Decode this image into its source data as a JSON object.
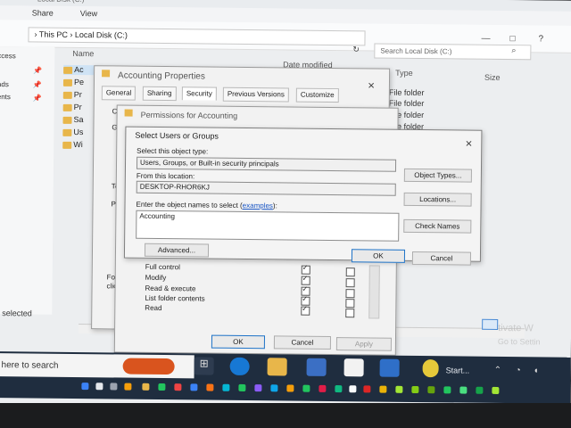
{
  "explorer": {
    "title": "Local Disk (C:)",
    "ribbon": [
      "Share",
      "View"
    ],
    "breadcrumb": [
      "This PC",
      "Local Disk (C:)"
    ],
    "search_placeholder": "Search Local Disk (C:)",
    "columns": [
      "Name",
      "Date modified",
      "Type",
      "Size"
    ],
    "nav_items": [
      "ccess",
      "ads",
      "ents"
    ],
    "folders": [
      "Ac",
      "Pe",
      "Pr",
      "Pr",
      "Sa",
      "Us",
      "Wi"
    ],
    "types": [
      "File folder",
      "File folder",
      "File folder",
      "File folder",
      "older"
    ],
    "status": "m selected"
  },
  "properties": {
    "title": "Accounting Properties",
    "tabs": [
      "General",
      "Sharing",
      "Security",
      "Previous Versions",
      "Customize"
    ],
    "side_labels": [
      "Ob",
      "Gr",
      "To",
      "Pe",
      "Fo",
      "clic"
    ]
  },
  "permissions": {
    "title": "Permissions for Accounting",
    "rows": [
      {
        "label": "Full control",
        "allow": true,
        "deny": false
      },
      {
        "label": "Modify",
        "allow": true,
        "deny": false
      },
      {
        "label": "Read & execute",
        "allow": true,
        "deny": false
      },
      {
        "label": "List folder contents",
        "allow": true,
        "deny": false
      },
      {
        "label": "Read",
        "allow": true,
        "deny": false
      }
    ],
    "buttons": {
      "ok": "OK",
      "cancel": "Cancel",
      "apply": "Apply"
    }
  },
  "select_users": {
    "title": "Select Users or Groups",
    "object_type_label": "Select this object type:",
    "object_type_value": "Users, Groups, or Built-in security principals",
    "object_types_button": "Object Types...",
    "location_label": "From this location:",
    "location_value": "DESKTOP-RHOR6KJ",
    "locations_button": "Locations...",
    "names_label_pre": "Enter the object names to select (",
    "names_label_link": "examples",
    "names_label_post": "):",
    "names_value": "Accounting",
    "check_names_button": "Check Names",
    "advanced_button": "Advanced...",
    "ok_button": "OK",
    "cancel_button": "Cancel"
  },
  "watermark": [
    "tivate W",
    "Go to Settin"
  ],
  "taskbar": {
    "search_placeholder": "pe here to search",
    "start_label": "Start..."
  }
}
